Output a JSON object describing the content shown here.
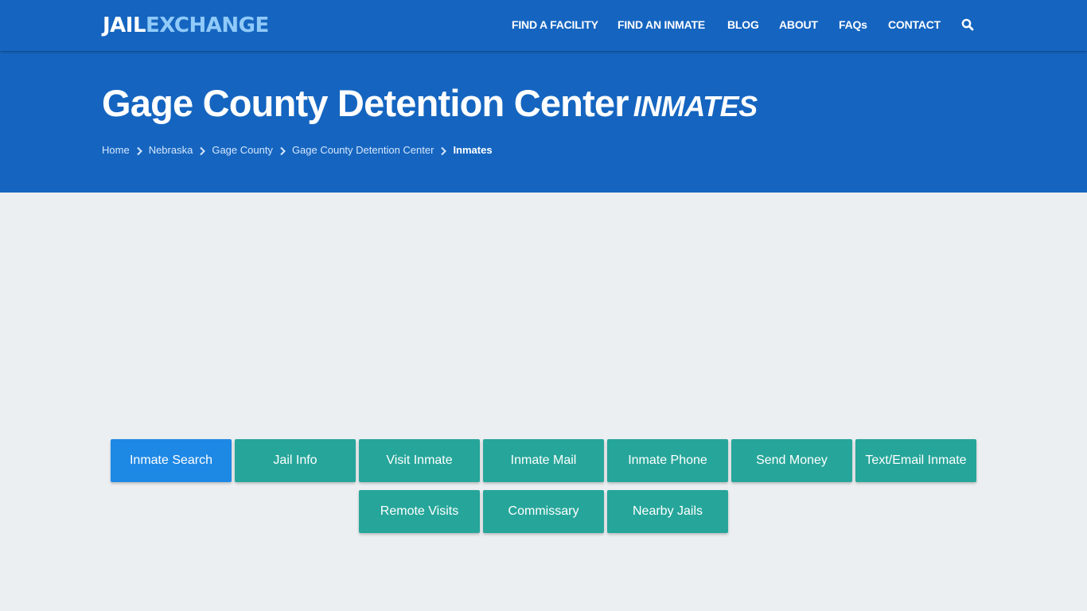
{
  "header": {
    "logo": {
      "part1": "JAIL",
      "part2": "EXCHANGE"
    },
    "nav": [
      {
        "label": "FIND A FACILITY"
      },
      {
        "label": "FIND AN INMATE"
      },
      {
        "label": "BLOG"
      },
      {
        "label": "ABOUT"
      },
      {
        "label": "FAQs"
      },
      {
        "label": "CONTACT"
      }
    ],
    "search_icon": "search-icon"
  },
  "hero": {
    "title": "Gage County Detention Center",
    "title_suffix": "INMATES",
    "breadcrumb": [
      {
        "label": "Home"
      },
      {
        "label": "Nebraska"
      },
      {
        "label": "Gage County"
      },
      {
        "label": "Gage County Detention Center"
      },
      {
        "label": "Inmates"
      }
    ]
  },
  "actions": {
    "colors": {
      "active": "#1e88e5",
      "default": "#26a69a",
      "header": "#1565c0",
      "logo_accent": "#90caf9"
    },
    "row1": [
      {
        "label": "Inmate Search",
        "active": true
      },
      {
        "label": "Jail Info"
      },
      {
        "label": "Visit Inmate"
      },
      {
        "label": "Inmate Mail"
      },
      {
        "label": "Inmate Phone"
      },
      {
        "label": "Send Money"
      },
      {
        "label": "Text/Email Inmate"
      }
    ],
    "row2": [
      {
        "label": "Remote Visits"
      },
      {
        "label": "Commissary"
      },
      {
        "label": "Nearby Jails"
      }
    ]
  }
}
